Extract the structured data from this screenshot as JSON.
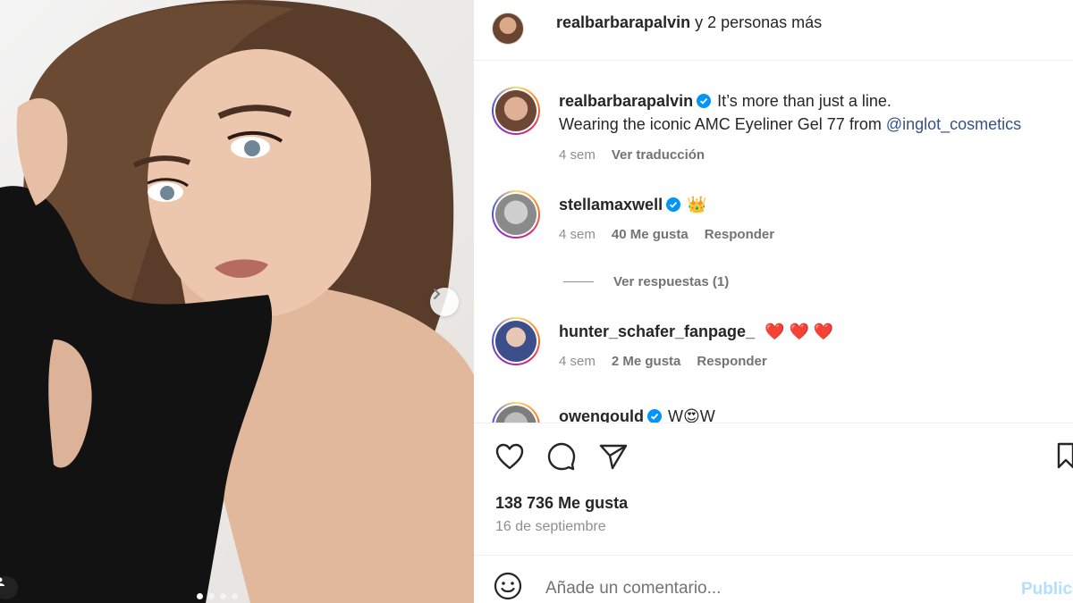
{
  "post": {
    "header": {
      "username": "realbarbarapalvin",
      "others": "y 2 personas más"
    },
    "carousel": {
      "slide_count": 4,
      "active_index": 0
    }
  },
  "caption": {
    "username": "realbarbarapalvin",
    "line1": "It’s more than just a line.",
    "line2_prefix": "Wearing the iconic AMC Eyeliner Gel 77 from",
    "mention": "@inglot_cosmetics",
    "time": "4 sem",
    "translate": "Ver traducción"
  },
  "comments": [
    {
      "username": "stellamaxwell",
      "verified": true,
      "text": "👑",
      "time": "4 sem",
      "likes": "40 Me gusta",
      "reply": "Responder"
    },
    {
      "username": "hunter_schafer_fanpage_",
      "verified": false,
      "text": "❤️ ❤️ ❤️",
      "time": "4 sem",
      "likes": "2 Me gusta",
      "reply": "Responder"
    },
    {
      "username": "owengould",
      "verified": true,
      "text": "W😍W"
    }
  ],
  "view_replies": "Ver respuestas (1)",
  "actions": {
    "like_icon": "heart-icon",
    "comment_icon": "comment-bubble-icon",
    "share_icon": "paper-plane-icon",
    "save_icon": "bookmark-icon"
  },
  "likes_count": "138 736 Me gusta",
  "date": "16 de septiembre",
  "comment_box": {
    "placeholder": "Añade un comentario...",
    "publish": "Publicar"
  },
  "colors": {
    "link": "#385185",
    "verified": "#0095f6",
    "publish_disabled": "#b2dffc",
    "heart": "#ed4956"
  }
}
